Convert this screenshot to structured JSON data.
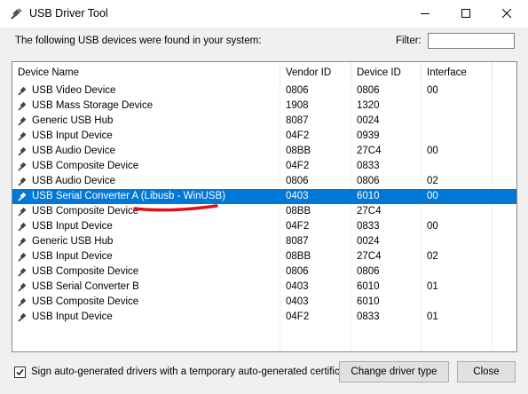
{
  "window": {
    "title": "USB Driver Tool",
    "icon": "usb-plug-icon"
  },
  "header": {
    "found_text": "The following USB devices were found in your system:",
    "filter_label": "Filter:",
    "filter_value": ""
  },
  "columns": [
    "Device Name",
    "Vendor ID",
    "Device ID",
    "Interface"
  ],
  "devices": [
    {
      "name": "USB Video Device",
      "vendor": "0806",
      "device": "0806",
      "iface": "00"
    },
    {
      "name": "USB Mass Storage Device",
      "vendor": "1908",
      "device": "1320",
      "iface": ""
    },
    {
      "name": "Generic USB Hub",
      "vendor": "8087",
      "device": "0024",
      "iface": ""
    },
    {
      "name": "USB Input Device",
      "vendor": "04F2",
      "device": "0939",
      "iface": ""
    },
    {
      "name": "USB Audio Device",
      "vendor": "08BB",
      "device": "27C4",
      "iface": "00"
    },
    {
      "name": "USB Composite Device",
      "vendor": "04F2",
      "device": "0833",
      "iface": ""
    },
    {
      "name": "USB Audio Device",
      "vendor": "0806",
      "device": "0806",
      "iface": "02"
    },
    {
      "name": "USB Serial Converter A (Libusb - WinUSB)",
      "vendor": "0403",
      "device": "6010",
      "iface": "00",
      "selected": true
    },
    {
      "name": "USB Composite Device",
      "vendor": "08BB",
      "device": "27C4",
      "iface": ""
    },
    {
      "name": "USB Input Device",
      "vendor": "04F2",
      "device": "0833",
      "iface": "00"
    },
    {
      "name": "Generic USB Hub",
      "vendor": "8087",
      "device": "0024",
      "iface": ""
    },
    {
      "name": "USB Input Device",
      "vendor": "08BB",
      "device": "27C4",
      "iface": "02"
    },
    {
      "name": "USB Composite Device",
      "vendor": "0806",
      "device": "0806",
      "iface": ""
    },
    {
      "name": "USB Serial Converter B",
      "vendor": "0403",
      "device": "6010",
      "iface": "01"
    },
    {
      "name": "USB Composite Device",
      "vendor": "0403",
      "device": "6010",
      "iface": ""
    },
    {
      "name": "USB Input Device",
      "vendor": "04F2",
      "device": "0833",
      "iface": "01"
    }
  ],
  "footer": {
    "checkbox_label": "Sign auto-generated drivers with a temporary auto-generated certificate",
    "checkbox_checked": true,
    "change_button": "Change driver type",
    "close_button": "Close"
  },
  "colors": {
    "selection": "#0078d7",
    "annotation_underline": "#e0101a"
  }
}
